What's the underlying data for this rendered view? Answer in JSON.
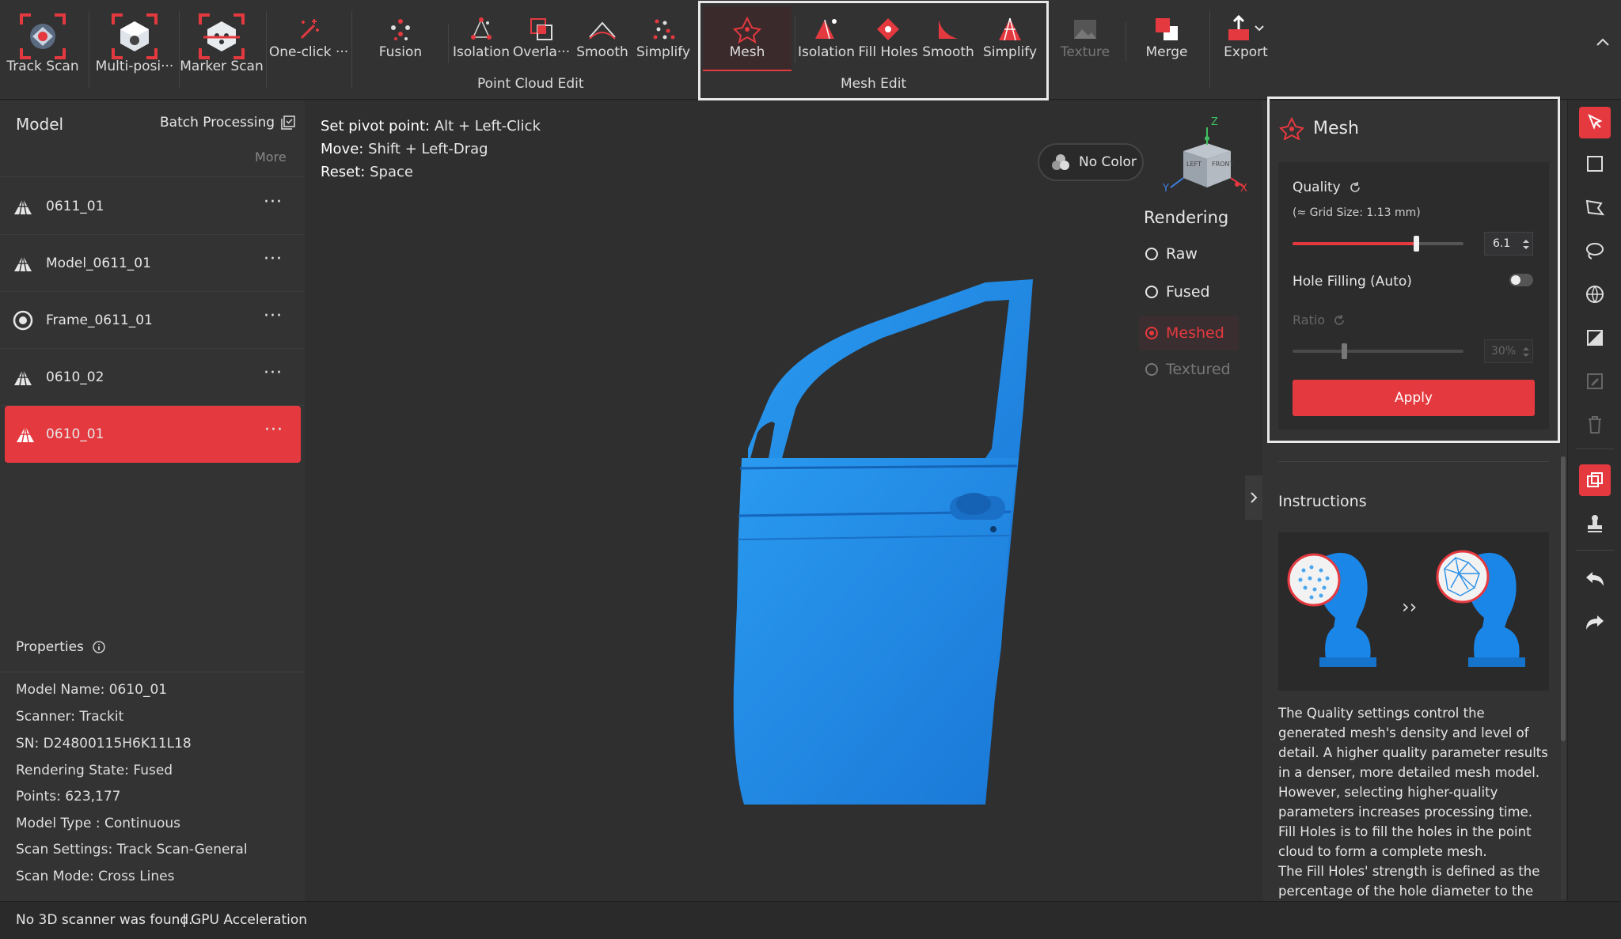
{
  "toolbar": {
    "buttons": [
      {
        "label": "Track Scan"
      },
      {
        "label": "Multi-posi···"
      },
      {
        "label": "Marker Scan"
      },
      {
        "label": "One-click ···"
      },
      {
        "label": "Fusion"
      },
      {
        "label": "Isolation"
      },
      {
        "label": "Overla···"
      },
      {
        "label": "Smooth"
      },
      {
        "label": "Simplify"
      },
      {
        "label": "Mesh"
      },
      {
        "label": "Isolation"
      },
      {
        "label": "Fill Holes"
      },
      {
        "label": "Smooth"
      },
      {
        "label": "Simplify"
      },
      {
        "label": "Texture"
      },
      {
        "label": "Merge"
      },
      {
        "label": "Export"
      }
    ],
    "group_point_cloud": "Point Cloud Edit",
    "group_mesh": "Mesh Edit"
  },
  "left": {
    "title": "Model",
    "batch": "Batch Processing",
    "more": "More",
    "models": [
      {
        "name": "0611_01",
        "icon": "mesh-triangle-icon"
      },
      {
        "name": "Model_0611_01",
        "icon": "mesh-triangle-icon"
      },
      {
        "name": "Frame_0611_01",
        "icon": "frame-target-icon"
      },
      {
        "name": "0610_02",
        "icon": "mesh-triangle-icon"
      },
      {
        "name": "0610_01",
        "icon": "mesh-triangle-icon"
      }
    ],
    "dots": "···",
    "properties_title": "Properties",
    "props": [
      "Model Name:  0610_01",
      "Scanner:  Trackit",
      "SN:  D24800115H6K11L18",
      "Rendering State:  Fused",
      "Points:  623,177",
      "Model Type :  Continuous",
      "Scan Settings:  Track Scan-General",
      "Scan Mode:  Cross Lines"
    ]
  },
  "viewport": {
    "hints": [
      {
        "key": "Set pivot point:",
        "val": "Alt + Left-Click"
      },
      {
        "key": "Move:",
        "val": "Shift + Left-Drag"
      },
      {
        "key": "Reset:",
        "val": "Space"
      }
    ],
    "no_color": "No Color",
    "rendering_title": "Rendering",
    "rendering_options": [
      "Raw",
      "Fused",
      "Meshed",
      "Textured"
    ],
    "rendering_selected": "Meshed",
    "cube_faces": {
      "left": "LEFT",
      "front": "FRONT"
    },
    "axes": {
      "x": "X",
      "y": "Y",
      "z": "Z"
    },
    "model_color": "#1f86e0"
  },
  "mesh_panel": {
    "title": "Mesh",
    "quality_label": "Quality",
    "grid_size": "(≈ Grid Size: 1.13 mm)",
    "quality_value": "6.1",
    "quality_fraction": 0.72,
    "hole_filling_label": "Hole Filling (Auto)",
    "hole_filling_on": false,
    "ratio_label": "Ratio",
    "ratio_value": "30%",
    "ratio_fraction": 0.3,
    "apply": "Apply"
  },
  "instructions": {
    "title": "Instructions",
    "text": [
      "The Quality settings control the generated mesh's density and level of detail. A higher quality parameter results in a denser, more detailed mesh model. However, selecting higher-quality parameters increases processing time.",
      "Fill Holes is to fill the holes in the point cloud to form a complete mesh.",
      "The Fill Holes' strength is defined as the percentage of the hole diameter to the"
    ],
    "arrow": "››"
  },
  "status": {
    "text": "No 3D scanner was found.",
    "gpu": "| GPU Acceleration"
  },
  "colors": {
    "accent": "#e4393f",
    "panel": "#333334",
    "viewport": "#2f2f30"
  }
}
